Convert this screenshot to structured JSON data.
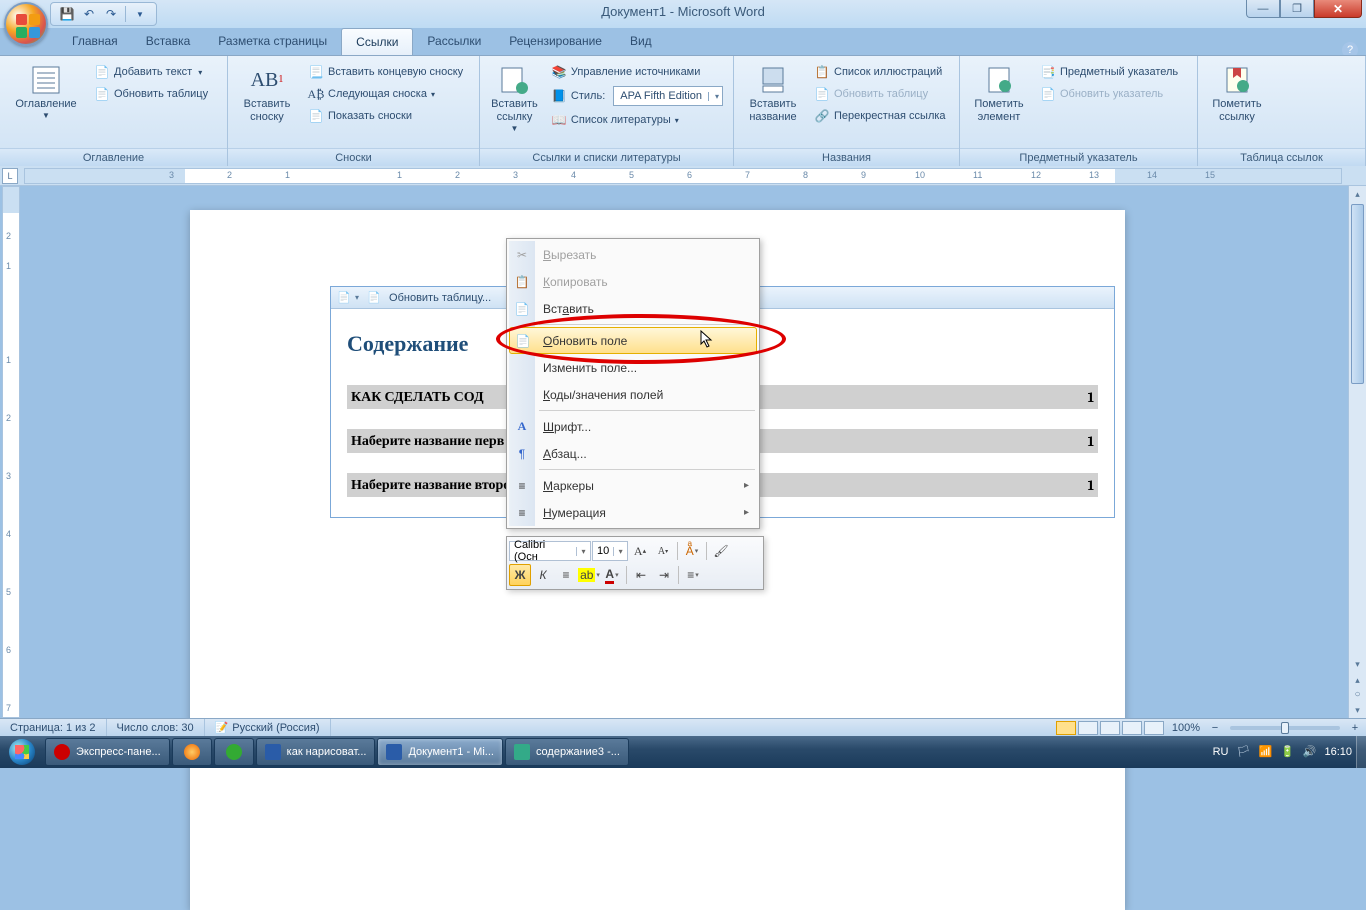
{
  "window": {
    "title": "Документ1 - Microsoft Word"
  },
  "tabs": {
    "home": "Главная",
    "insert": "Вставка",
    "layout": "Разметка страницы",
    "references": "Ссылки",
    "mailings": "Рассылки",
    "review": "Рецензирование",
    "view": "Вид"
  },
  "ribbon": {
    "toc_group": "Оглавление",
    "toc_btn": "Оглавление",
    "add_text": "Добавить текст",
    "update_table": "Обновить таблицу",
    "footnotes_group": "Сноски",
    "insert_footnote": "Вставить сноску",
    "insert_footnote_sup": "1",
    "insert_endnote": "Вставить концевую сноску",
    "next_footnote": "Следующая сноска",
    "show_notes": "Показать сноски",
    "citations_group": "Ссылки и списки литературы",
    "insert_citation": "Вставить ссылку",
    "manage_sources": "Управление источниками",
    "style_label": "Стиль:",
    "style_value": "APA Fifth Edition",
    "bibliography": "Список литературы",
    "captions_group": "Названия",
    "insert_caption": "Вставить название",
    "figures_list": "Список иллюстраций",
    "update_table2": "Обновить таблицу",
    "crossref": "Перекрестная ссылка",
    "index_group": "Предметный указатель",
    "mark_entry": "Пометить элемент",
    "index": "Предметный указатель",
    "update_index": "Обновить указатель",
    "authorities_group": "Таблица ссылок",
    "mark_citation": "Пометить ссылку"
  },
  "toc_field": {
    "update": "Обновить таблицу...",
    "title": "Содержание",
    "row1_text": "КАК СДЕЛАТЬ СОД",
    "row1_page": "1",
    "row2_text": "Наберите название перв",
    "row2_page": "1",
    "row3_text": "Наберите название второго раздела",
    "row3_page": "1"
  },
  "ctx": {
    "cut": "Вырезать",
    "copy": "Копировать",
    "paste": "Вставить",
    "update_field": "Обновить поле",
    "edit_field": "Изменить поле...",
    "toggle_codes": "Коды/значения полей",
    "font": "Шрифт...",
    "paragraph": "Абзац...",
    "bullets": "Маркеры",
    "numbering": "Нумерация"
  },
  "minitb": {
    "font": "Calibri (Осн",
    "size": "10"
  },
  "status": {
    "page": "Страница: 1 из 2",
    "words": "Число слов: 30",
    "lang": "Русский (Россия)",
    "zoom": "100%"
  },
  "taskbar": {
    "t1": "Экспресс-пане...",
    "t2": "как нарисоват...",
    "t3": "Документ1 - Mi...",
    "t4": "содержание3 -...",
    "lang": "RU",
    "time": "16:10"
  }
}
